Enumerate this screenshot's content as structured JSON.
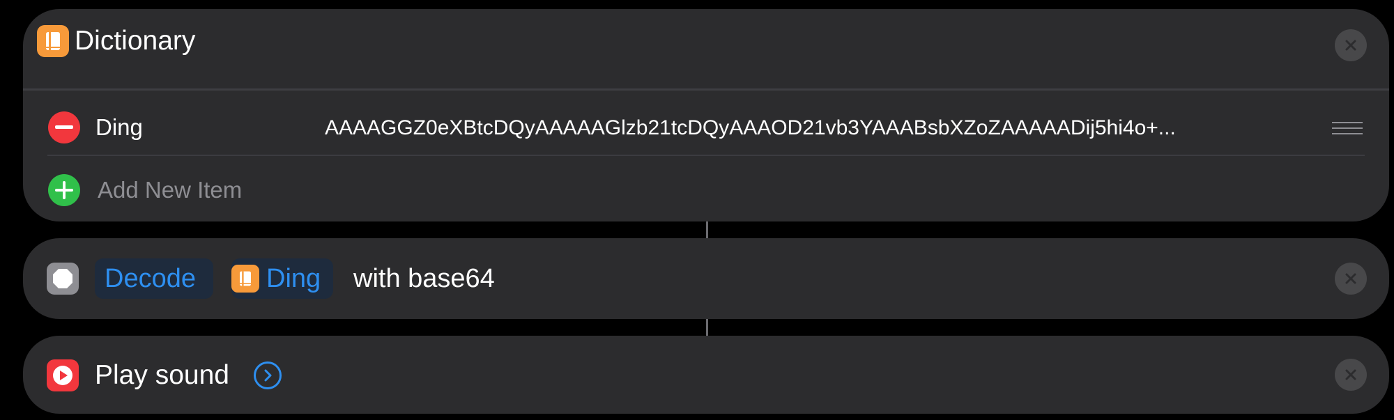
{
  "dictionary_action": {
    "title": "Dictionary",
    "icon": "book-icon",
    "items": [
      {
        "key": "Ding",
        "value": "AAAAGGZ0eXBtcDQyAAAAAGlzb21tcDQyAAAOD21vb3YAAABsbXZoZAAAAADij5hi4o+..."
      }
    ],
    "add_label": "Add New Item"
  },
  "decode_action": {
    "icon": "stop-octagon-icon",
    "operation_token": "Decode",
    "variable_token": "Ding",
    "variable_icon": "book-icon",
    "suffix": "with base64"
  },
  "play_action": {
    "title": "Play sound",
    "icon": "play-circle-icon"
  },
  "colors": {
    "background": "#000000",
    "card": "#2c2c2e",
    "accent_blue": "#2e8ff0",
    "orange": "#f79a3a",
    "red": "#f2373d",
    "green": "#30c04a",
    "close_button": "#48484a"
  }
}
